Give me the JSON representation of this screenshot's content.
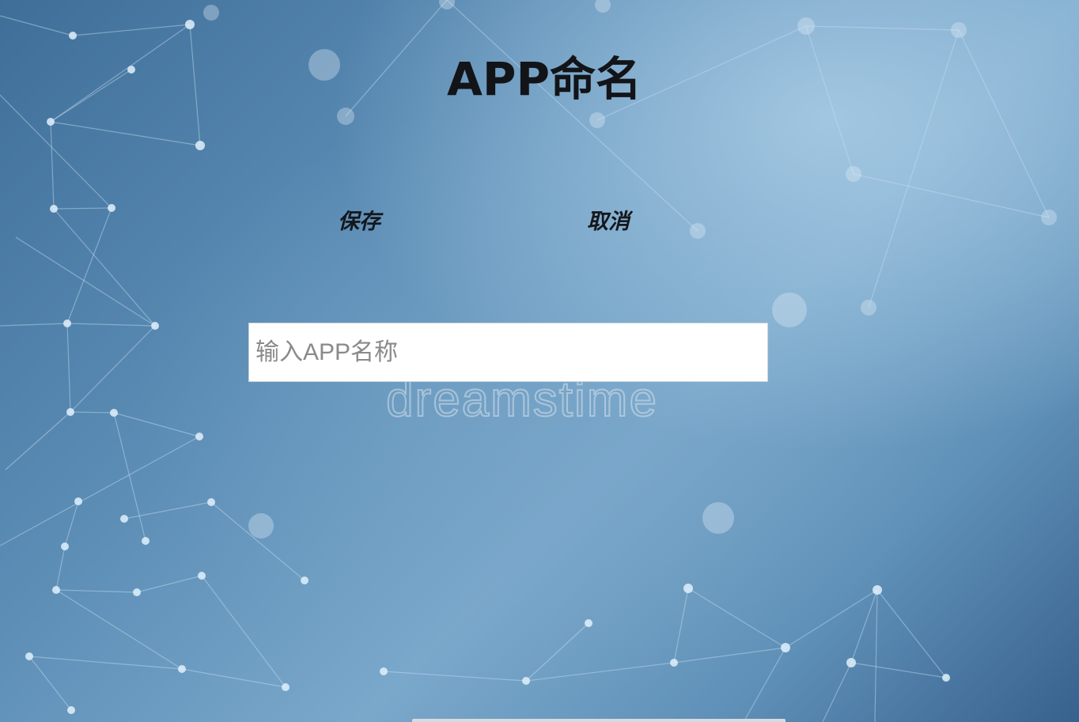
{
  "page": {
    "title": "APP命名"
  },
  "actions": {
    "save_label": "保存",
    "cancel_label": "取消"
  },
  "form": {
    "name_placeholder": "输入APP名称",
    "name_value": ""
  },
  "background": {
    "watermark": "dreamstime"
  },
  "colors": {
    "background_top": "#7aa8cb",
    "background_edge": "#37618e",
    "text": "#121417",
    "input_background": "#ffffff"
  }
}
